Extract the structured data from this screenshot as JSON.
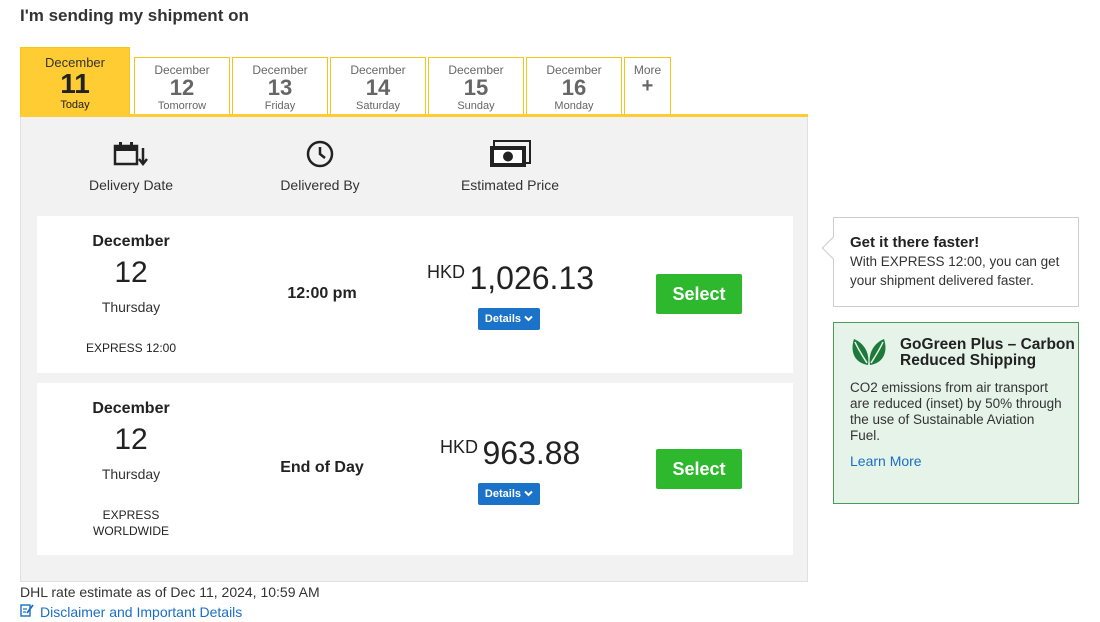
{
  "page": {
    "title": "I'm sending my shipment on"
  },
  "tabs": [
    {
      "month": "December",
      "day": "11",
      "label": "Today",
      "active": true
    },
    {
      "month": "December",
      "day": "12",
      "label": "Tomorrow"
    },
    {
      "month": "December",
      "day": "13",
      "label": "Friday"
    },
    {
      "month": "December",
      "day": "14",
      "label": "Saturday"
    },
    {
      "month": "December",
      "day": "15",
      "label": "Sunday"
    },
    {
      "month": "December",
      "day": "16",
      "label": "Monday"
    }
  ],
  "more_tab": {
    "label": "More",
    "symbol": "+"
  },
  "columns": {
    "delivery_date": "Delivery Date",
    "delivered_by": "Delivered By",
    "estimated_price": "Estimated Price"
  },
  "options": [
    {
      "month": "December",
      "day": "12",
      "weekday": "Thursday",
      "service": "EXPRESS 12:00",
      "delivered_by": "12:00 pm",
      "currency": "HKD",
      "price": "1,026.13",
      "details_label": "Details",
      "select_label": "Select"
    },
    {
      "month": "December",
      "day": "12",
      "weekday": "Thursday",
      "service_line1": "EXPRESS",
      "service_line2": "WORLDWIDE",
      "delivered_by": "End of Day",
      "currency": "HKD",
      "price": "963.88",
      "details_label": "Details",
      "select_label": "Select"
    }
  ],
  "footer": {
    "estimate_note": "DHL rate estimate as of Dec 11, 2024, 10:59 AM",
    "disclaimer_link": "Disclaimer and Important Details"
  },
  "tip": {
    "title": "Get it there faster!",
    "body": "With EXPRESS 12:00, you can get your shipment delivered faster."
  },
  "gogreen": {
    "title": "GoGreen Plus – Carbon Reduced Shipping",
    "body": "CO2 emissions from air transport are reduced (inset) by 50% through the use of Sustainable Aviation Fuel.",
    "link": "Learn More"
  },
  "colors": {
    "accent_yellow": "#ffcc33",
    "select_green": "#2eb82e",
    "details_blue": "#1a73c8",
    "link_blue": "#1a6fc4",
    "gogreen_leaf": "#1e7a3a"
  }
}
